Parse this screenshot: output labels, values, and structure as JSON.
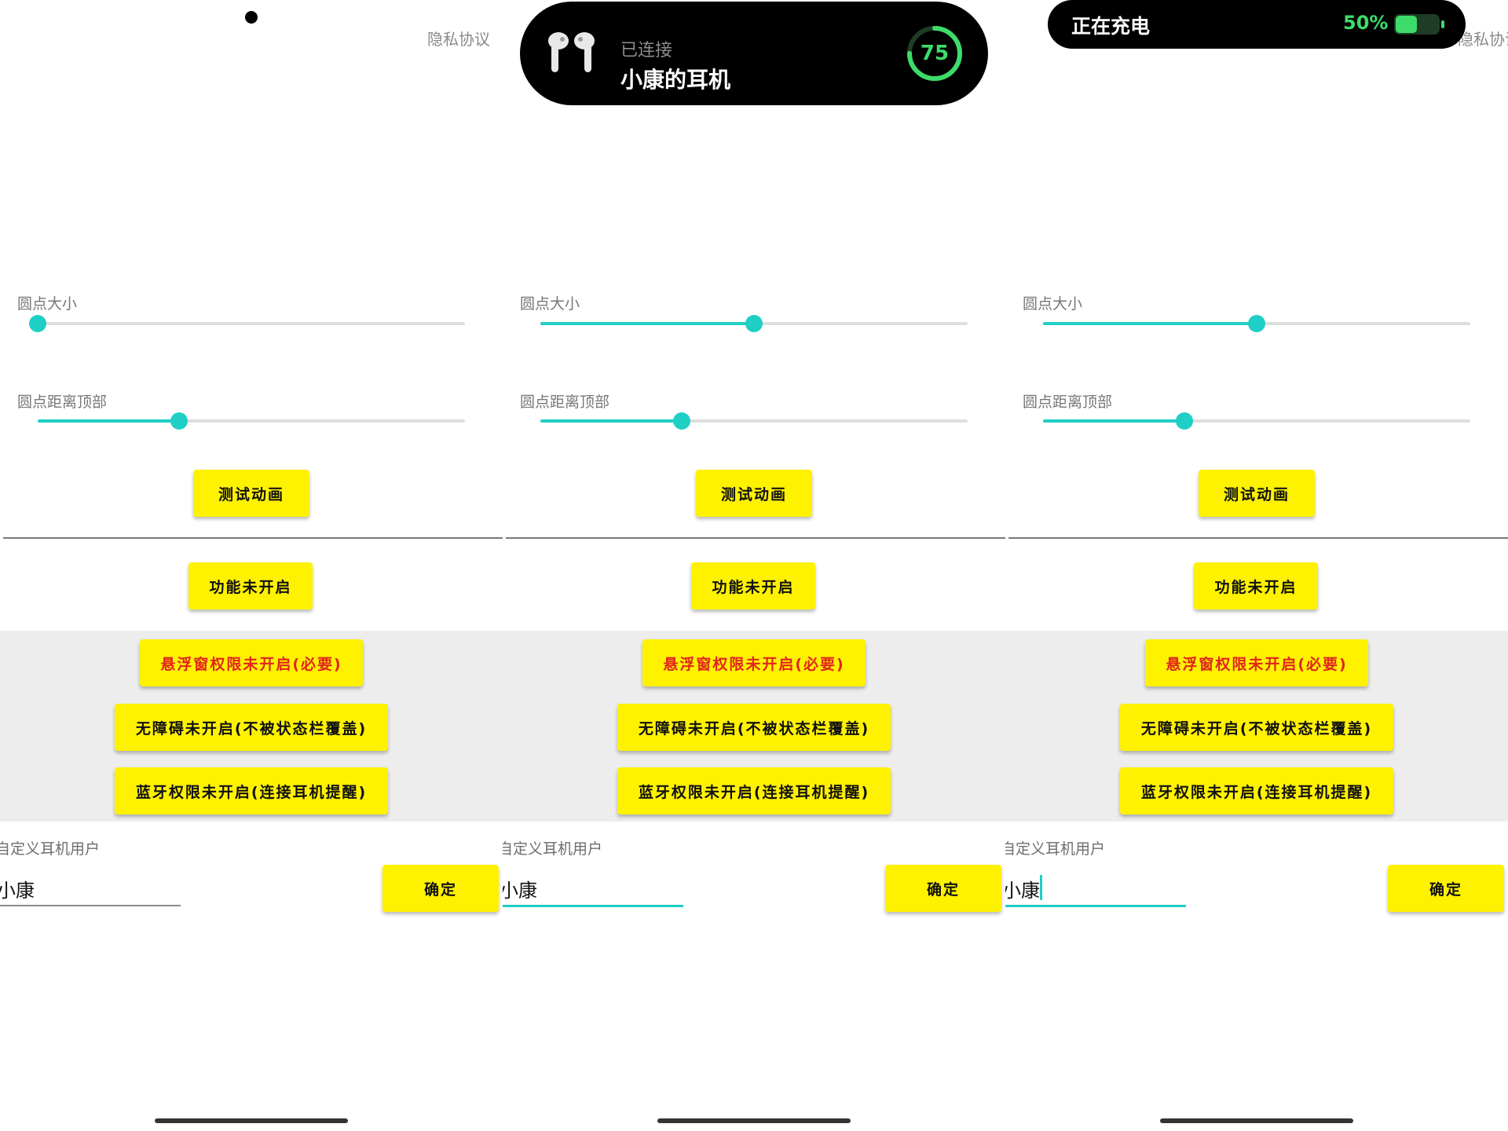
{
  "privacy_link": "隐私协议",
  "sliders": {
    "dot_size_label": "圆点大小",
    "dot_top_label": "圆点距离顶部"
  },
  "panels": [
    {
      "dot_size_value": 0.0,
      "dot_top_value": 0.33,
      "input_focused": false
    },
    {
      "dot_size_value": 0.5,
      "dot_top_value": 0.33,
      "input_focused": true
    },
    {
      "dot_size_value": 0.5,
      "dot_top_value": 0.33,
      "input_focused": true
    }
  ],
  "buttons": {
    "test_animation": "测试动画",
    "feature_off": "功能未开启",
    "overlay_permission": "悬浮窗权限未开启(必要)",
    "accessibility": "无障碍未开启(不被状态栏覆盖)",
    "bluetooth_permission": "蓝牙权限未开启(连接耳机提醒)",
    "confirm": "确定"
  },
  "custom_user": {
    "label": "自定义耳机用户",
    "value": "小康"
  },
  "headphone_island": {
    "status": "已连接",
    "device_name": "小康的耳机",
    "battery_percent": 75,
    "battery_text": "75"
  },
  "charging_pill": {
    "label": "正在充电",
    "percent_text": "50%",
    "level": 0.5
  },
  "colors": {
    "accent": "#1fcfc5",
    "button_yellow": "#fff200",
    "warning_red": "#e1251b",
    "battery_green": "#3ddc6a"
  }
}
